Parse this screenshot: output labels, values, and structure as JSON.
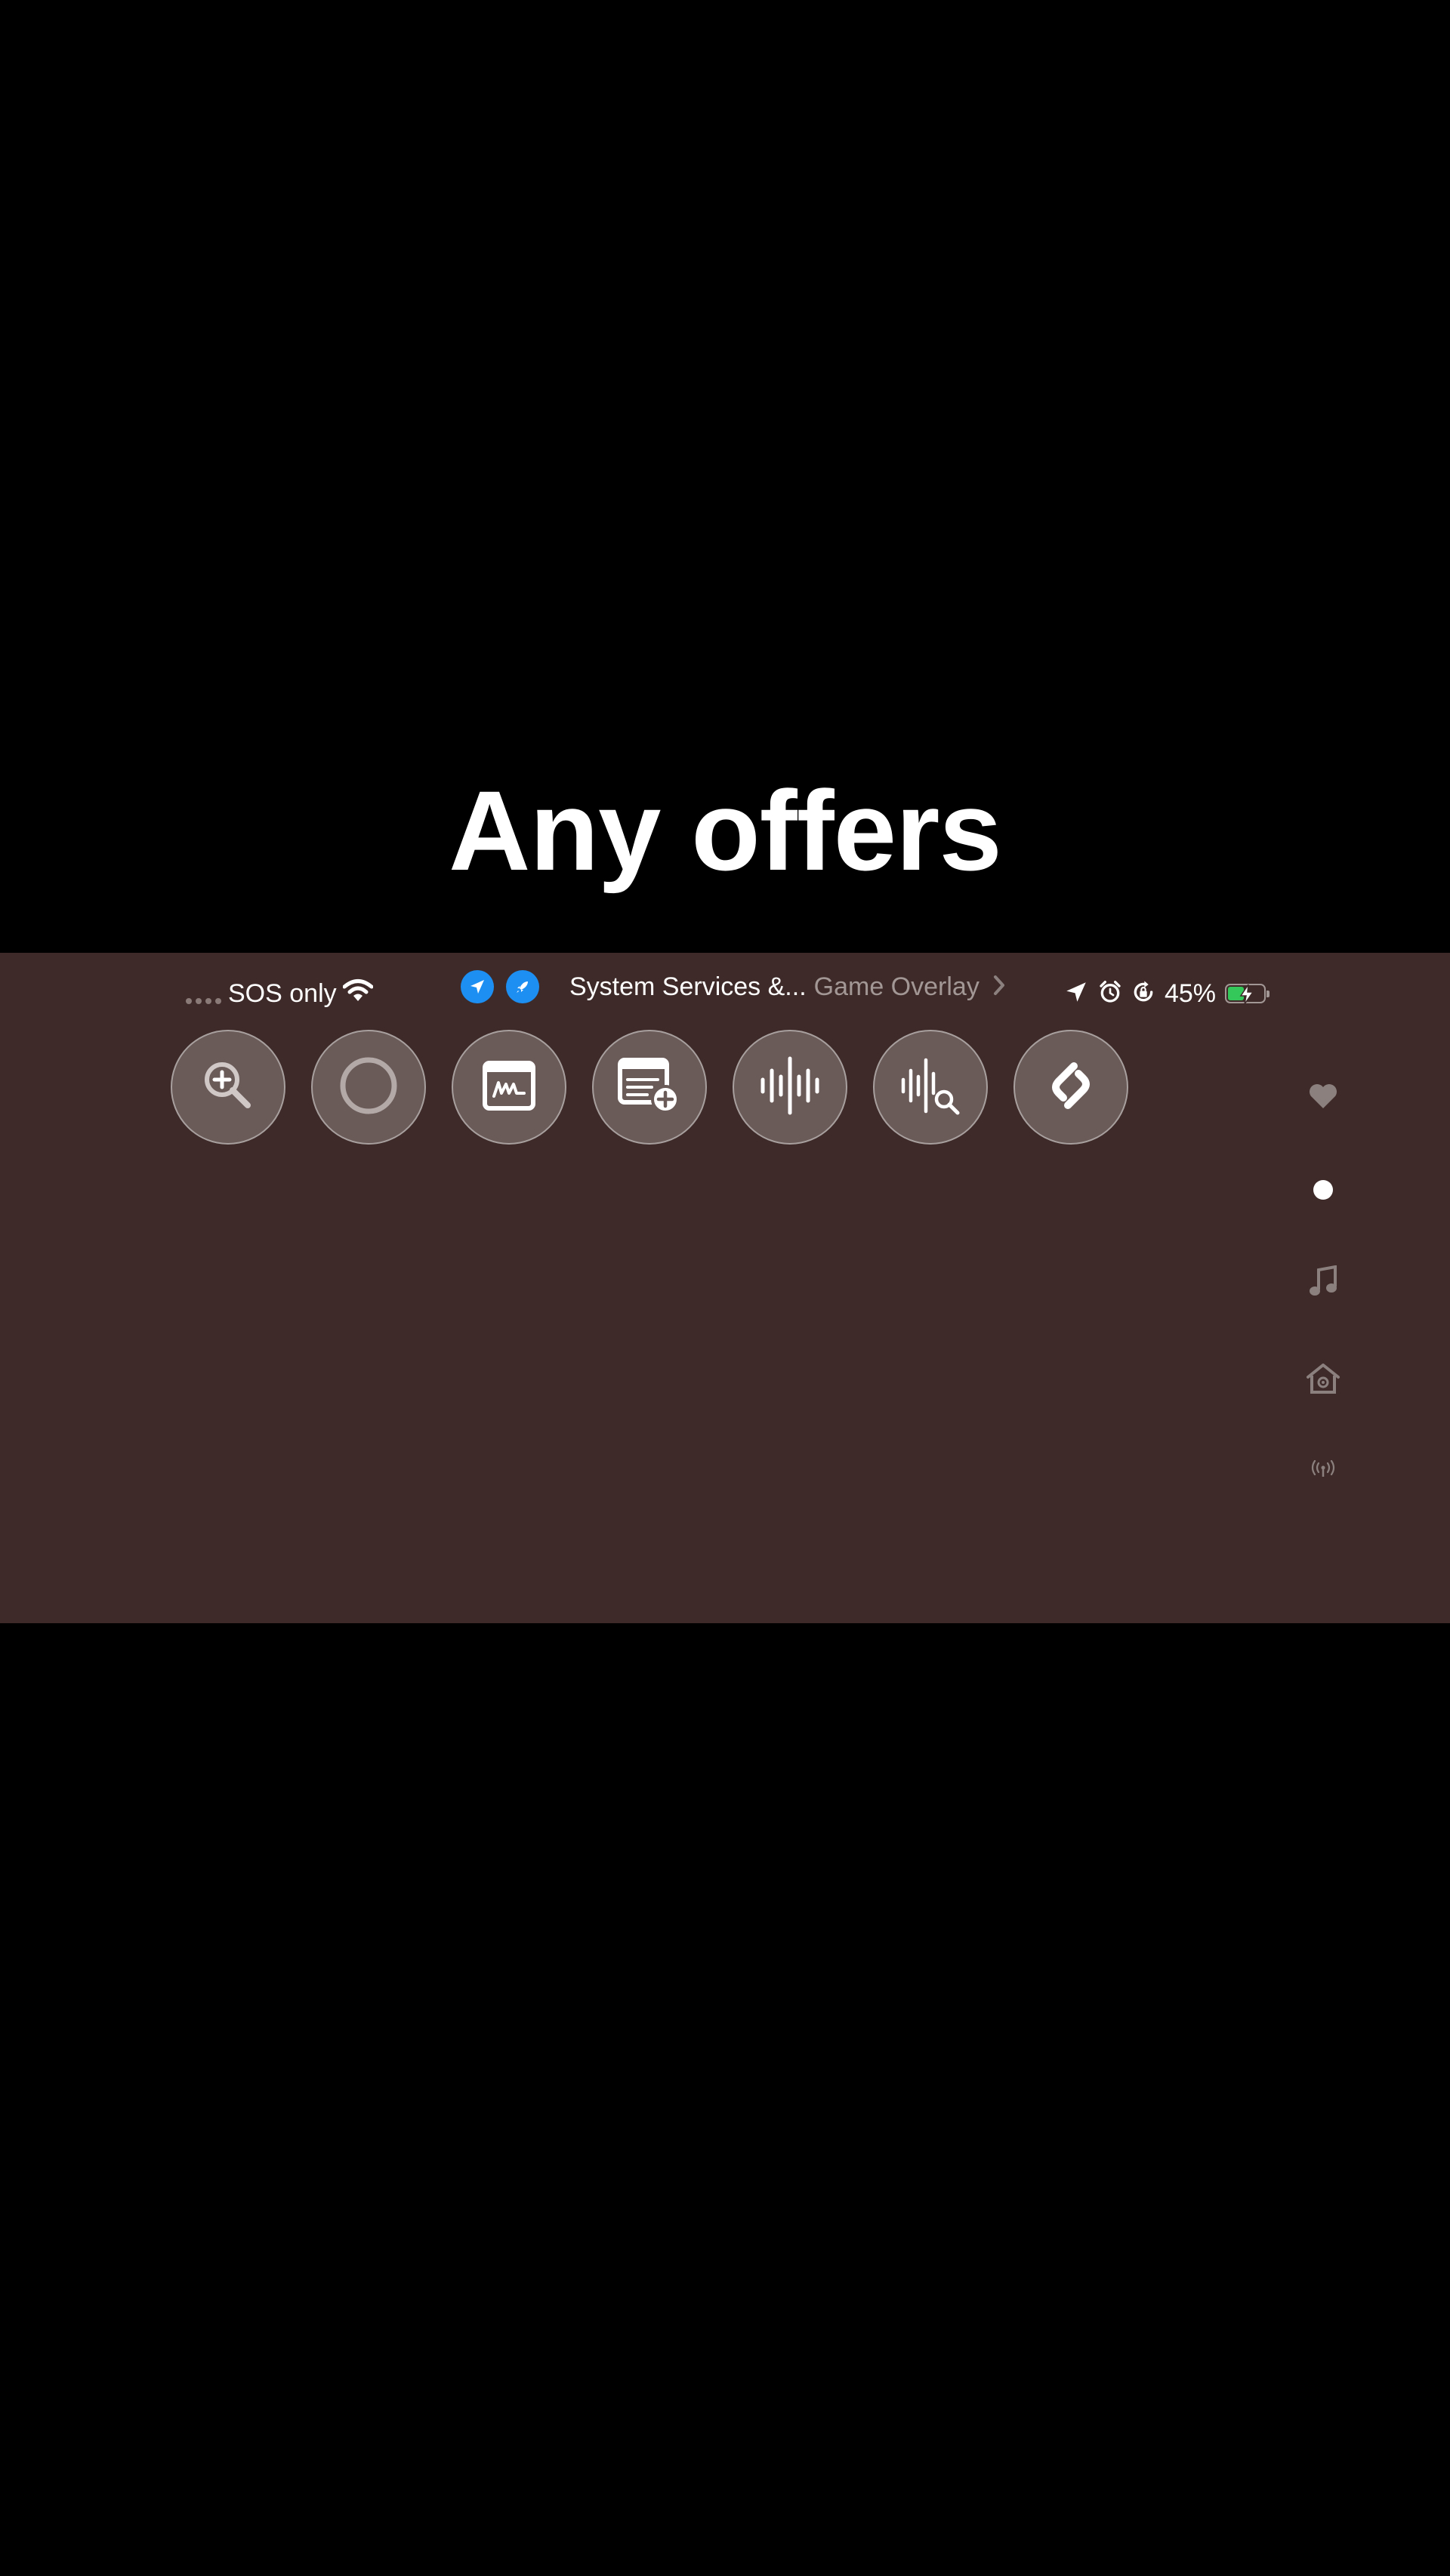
{
  "caption": {
    "text": "Any offers"
  },
  "status_bar": {
    "carrier": "SOS only",
    "activity": {
      "app_label": "System Services &...",
      "detail_label": "Game Overlay"
    },
    "battery": {
      "percent_label": "45%",
      "level": 0.45,
      "charging": true
    }
  },
  "controls": [
    {
      "name": "magnifier",
      "icon": "zoom-in-icon"
    },
    {
      "name": "screen-recording",
      "icon": "record-circle-icon"
    },
    {
      "name": "quick-note",
      "icon": "signature-icon"
    },
    {
      "name": "new-note",
      "icon": "note-add-icon"
    },
    {
      "name": "voice-memos",
      "icon": "waveform-icon"
    },
    {
      "name": "music-recognition-search",
      "icon": "waveform-search-icon"
    },
    {
      "name": "shazam",
      "icon": "shazam-icon"
    }
  ],
  "page_indicator": {
    "pages": [
      "heart-icon",
      "dot-icon",
      "music-note-icon",
      "home-icon",
      "broadcast-icon"
    ],
    "active_index": 1
  },
  "colors": {
    "panel_bg": "#3e2b29",
    "button_bg": "#6a5a58",
    "accent_blue": "#1d8ff2",
    "battery_green": "#34c759"
  }
}
